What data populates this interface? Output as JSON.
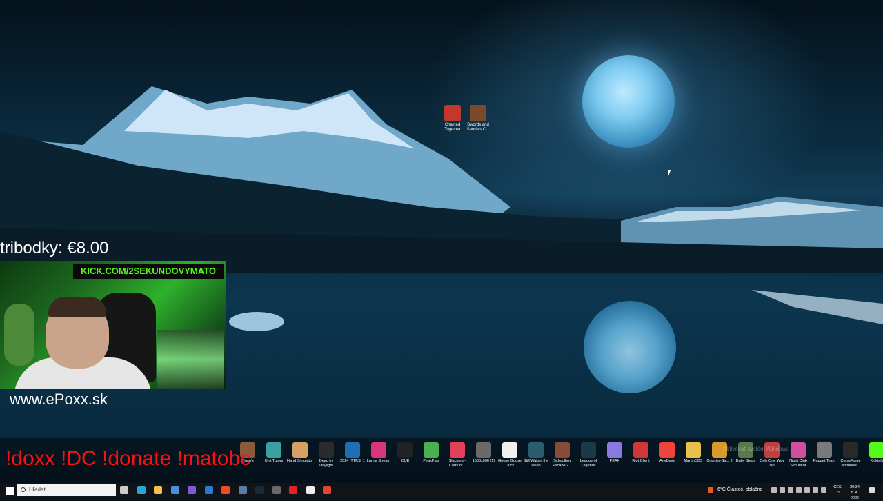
{
  "overlay": {
    "donation_text": "tribodky: €8.00",
    "kick_banner": "KICK.COM/2SEKUNDOVYMATO",
    "website": "www.ePoxx.sk",
    "commands": "!doxx  !DC !donate !matobc"
  },
  "desktop_icons": [
    {
      "label": "Chained Together",
      "color": "#c0392b",
      "icon": "chained-together-icon"
    },
    {
      "label": "Swords and Sandals C...",
      "color": "#7a4a2a",
      "icon": "swords-sandals-icon"
    }
  ],
  "taskbar_apps": [
    {
      "label": "Them's",
      "color": "#8a5a3a"
    },
    {
      "label": "Unit Tutors",
      "color": "#3aa1a0"
    },
    {
      "label": "Hand Simulator",
      "color": "#d9a066"
    },
    {
      "label": "Dead by Daylight",
      "color": "#2b2b2b"
    },
    {
      "label": "2024_TTRS_1",
      "color": "#1e6fb5"
    },
    {
      "label": "Lumia Stream",
      "color": "#d8367a"
    },
    {
      "label": "iCUE",
      "color": "#222222"
    },
    {
      "label": "PeakPals",
      "color": "#4caf50"
    },
    {
      "label": "Slackers - Carts of...",
      "color": "#e0405a"
    },
    {
      "label": "1500x500 (1)",
      "color": "#6a6a6a"
    },
    {
      "label": "Goose Goose Duck",
      "color": "#f0f0f0"
    },
    {
      "label": "Still Wakes the Deep",
      "color": "#2a5e6e"
    },
    {
      "label": "Schoolboy Escape 2...",
      "color": "#8a4a3a"
    },
    {
      "label": "League of Legends",
      "color": "#1a3a4a"
    },
    {
      "label": "PEAK",
      "color": "#8a7ae0"
    },
    {
      "label": "Riot Client",
      "color": "#d13639"
    },
    {
      "label": "AnyDesk",
      "color": "#ef443b"
    },
    {
      "label": "MartinOBS",
      "color": "#e8c14a"
    },
    {
      "label": "Counter-Str... 2",
      "color": "#d89a2a"
    },
    {
      "label": "Baby Steps",
      "color": "#5a7a4a"
    },
    {
      "label": "Only One Way Up",
      "color": "#c04040"
    },
    {
      "label": "Night Club Simulator",
      "color": "#d050a0"
    },
    {
      "label": "Puppet Team",
      "color": "#7a7a7a"
    },
    {
      "label": "CurseForge Windows...",
      "color": "#2a2a2a"
    },
    {
      "label": "Kicktalk",
      "color": "#53fc18"
    }
  ],
  "activation_watermark": "Aktivovať systém Windows",
  "taskbar": {
    "search_placeholder": "Hľadať",
    "weather": "6°C  Čiastoč. oblačno",
    "lang_top": "CES",
    "lang_bottom": "CS",
    "time": "20:34",
    "date": "8. 4. 2026",
    "pinned": [
      {
        "name": "task-view-icon",
        "color": "#cccccc"
      },
      {
        "name": "edge-icon",
        "color": "#2aa7d8"
      },
      {
        "name": "file-explorer-icon",
        "color": "#f2c14e"
      },
      {
        "name": "store-icon",
        "color": "#4a8fd8"
      },
      {
        "name": "copilot-icon",
        "color": "#7d5cd6"
      },
      {
        "name": "mail-icon",
        "color": "#2f78d0"
      },
      {
        "name": "brave-icon",
        "color": "#f04b23"
      },
      {
        "name": "app-icon",
        "color": "#5b7ea8"
      },
      {
        "name": "steam-icon",
        "color": "#1b2838"
      },
      {
        "name": "settings-icon",
        "color": "#6a6a6a"
      },
      {
        "name": "opera-icon",
        "color": "#e0222a"
      },
      {
        "name": "obs-icon",
        "color": "#eeeeee"
      },
      {
        "name": "chrome-icon",
        "color": "#e94235"
      }
    ]
  }
}
